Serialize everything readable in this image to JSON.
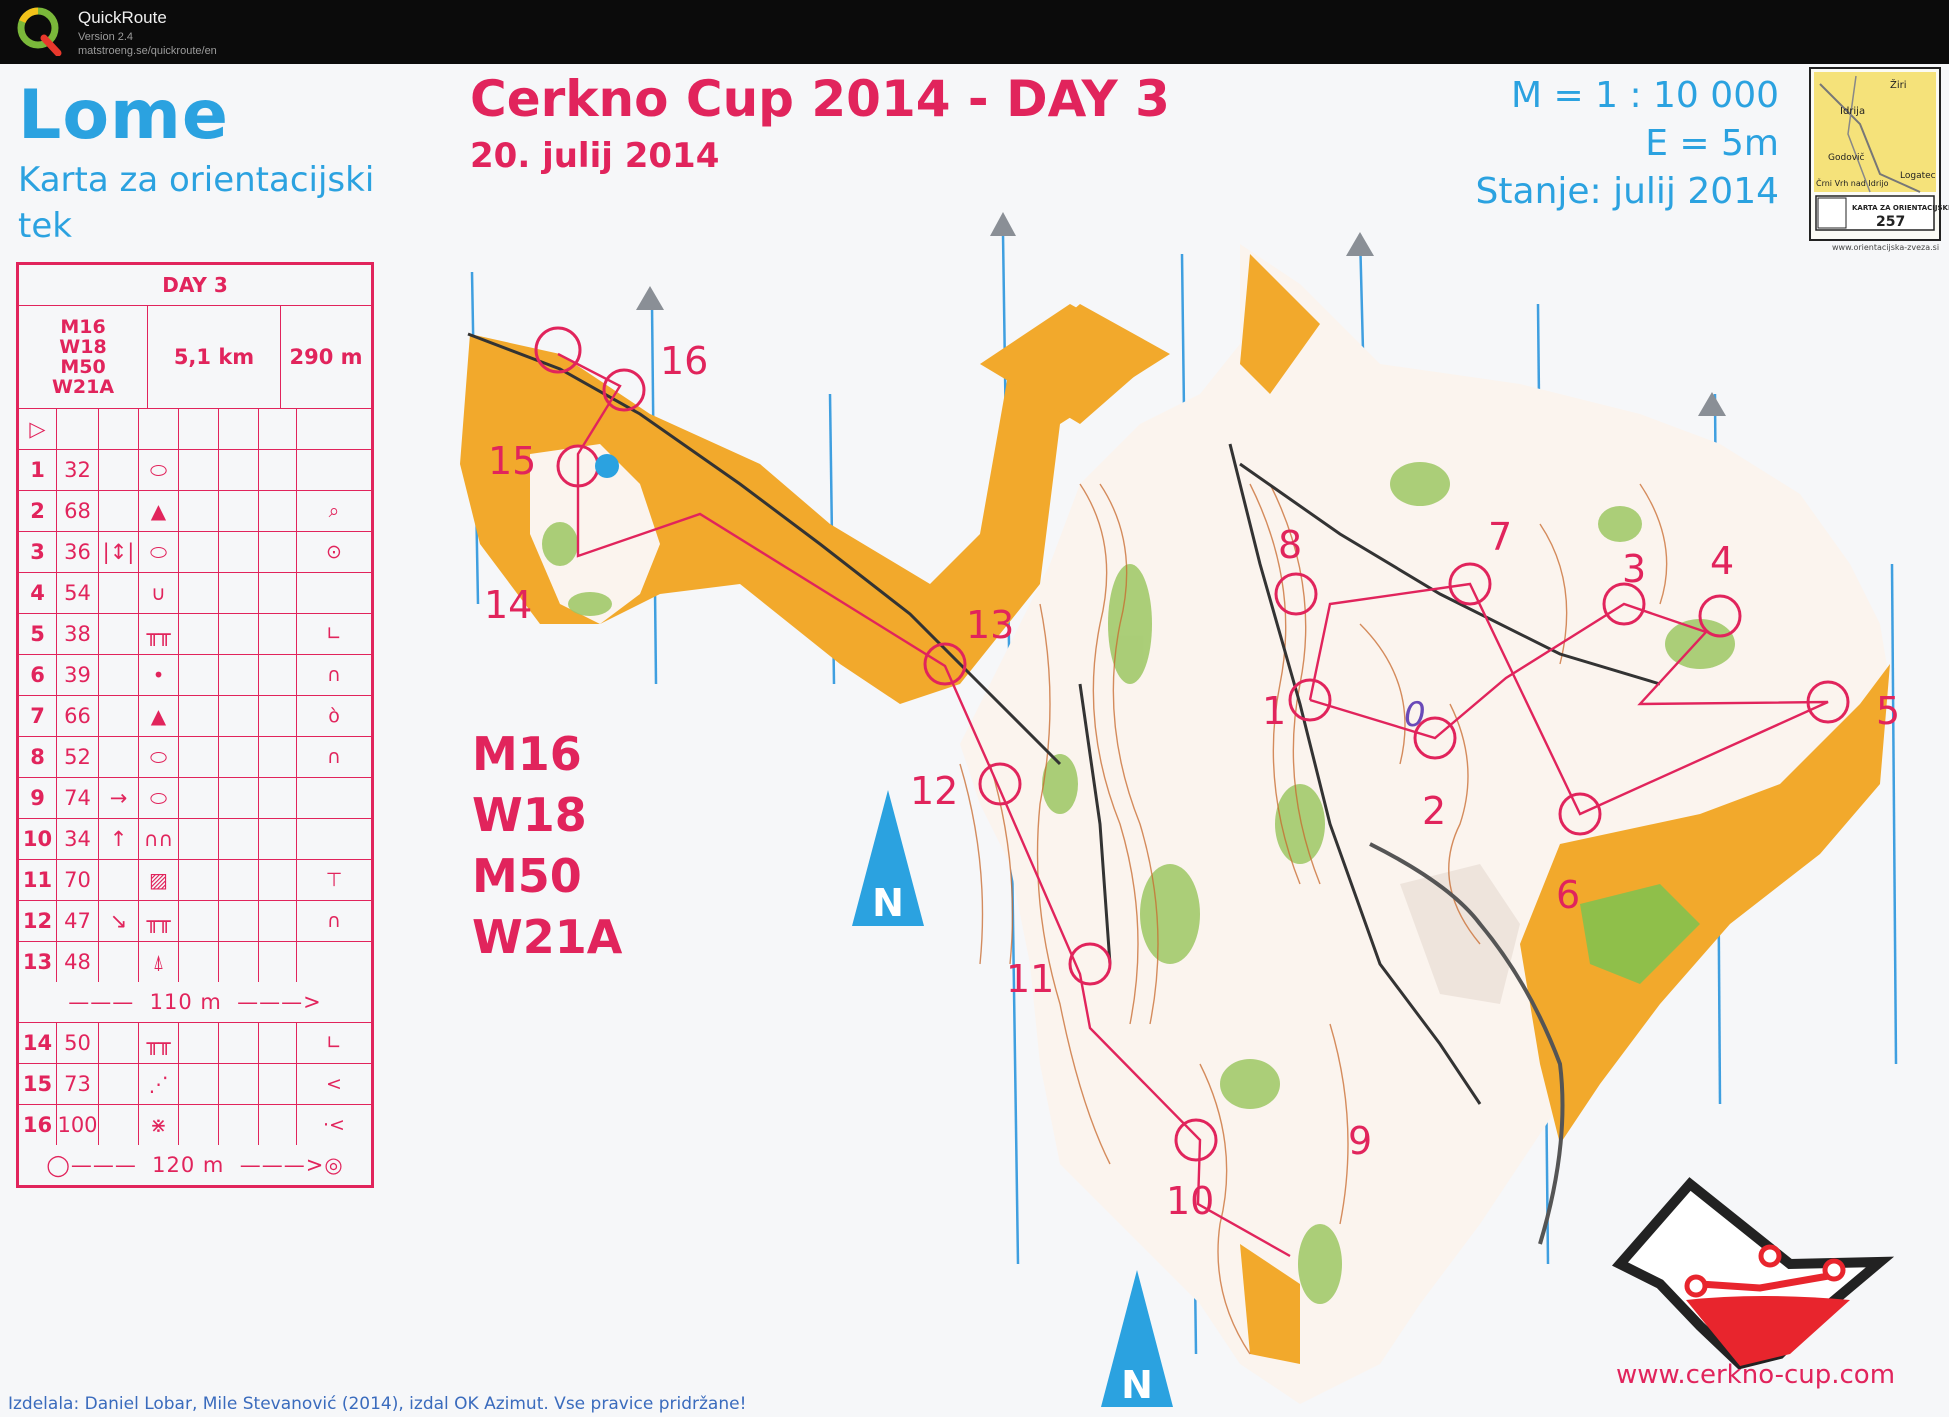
{
  "app": {
    "name": "QuickRoute",
    "version": "Version 2.4",
    "url": "matstroeng.se/quickroute/en"
  },
  "map": {
    "area_name": "Lome",
    "subtitle": "Karta za orientacijski tek",
    "event_title": "Cerkno Cup 2014 - DAY 3",
    "event_date": "20. julij 2014",
    "scale": "M = 1 : 10 000",
    "contour": "E = 5m",
    "status": "Stanje: julij 2014",
    "categories": [
      "M16",
      "W18",
      "M50",
      "W21A"
    ],
    "website": "www.cerkno-cup.com",
    "credits": "Izdelala: Daniel Lobar, Mile Stevanović (2014), izdal OK Azimut. Vse pravice pridržane!",
    "north_label": "N",
    "inset": {
      "places": [
        "Žiri",
        "Idrija",
        "Godovič",
        "Logatec",
        "Črni Vrh nad Idrijo"
      ],
      "badge_text": "KARTA ZA ORIENTACIJSKI TEK",
      "badge_number": "257",
      "url": "www.orientacijska-zveza.si"
    },
    "control_labels": [
      "1",
      "2",
      "3",
      "4",
      "5",
      "6",
      "7",
      "8",
      "9",
      "10",
      "11",
      "12",
      "13",
      "14",
      "15",
      "16"
    ]
  },
  "control_description": {
    "day": "DAY 3",
    "classes": [
      "M16",
      "W18",
      "M50",
      "W21A"
    ],
    "length": "5,1 km",
    "climb": "290 m",
    "start_symbol": "▷",
    "controls": [
      {
        "num": "1",
        "code": "32",
        "a": "",
        "sym": "⬭",
        "h": ""
      },
      {
        "num": "2",
        "code": "68",
        "a": "",
        "sym": "▲",
        "h": "⌕"
      },
      {
        "num": "3",
        "code": "36",
        "a": "|↕|",
        "sym": "⬭",
        "h": "⊙"
      },
      {
        "num": "4",
        "code": "54",
        "a": "",
        "sym": "∪",
        "h": ""
      },
      {
        "num": "5",
        "code": "38",
        "a": "",
        "sym": "╥╥",
        "h": "∟"
      },
      {
        "num": "6",
        "code": "39",
        "a": "",
        "sym": "•",
        "h": "∩"
      },
      {
        "num": "7",
        "code": "66",
        "a": "",
        "sym": "▲",
        "h": "ὸ"
      },
      {
        "num": "8",
        "code": "52",
        "a": "",
        "sym": "⬭",
        "h": "∩"
      },
      {
        "num": "9",
        "code": "74",
        "a": "→",
        "sym": "⬭",
        "h": ""
      },
      {
        "num": "10",
        "code": "34",
        "a": "↑",
        "sym": "∩∩",
        "h": ""
      },
      {
        "num": "11",
        "code": "70",
        "a": "",
        "sym": "▨",
        "h": "⊤"
      },
      {
        "num": "12",
        "code": "47",
        "a": "↘",
        "sym": "╥╥",
        "h": "∩"
      },
      {
        "num": "13",
        "code": "48",
        "a": "",
        "sym": "⍋",
        "h": ""
      }
    ],
    "marked_route_1": "110 m",
    "controls_2": [
      {
        "num": "14",
        "code": "50",
        "a": "",
        "sym": "╥╥",
        "h": "∟"
      },
      {
        "num": "15",
        "code": "73",
        "a": "",
        "sym": "⋰",
        "h": "<"
      },
      {
        "num": "16",
        "code": "100",
        "a": "",
        "sym": "⋇",
        "h": "·<"
      }
    ],
    "finish_route": "120 m"
  }
}
